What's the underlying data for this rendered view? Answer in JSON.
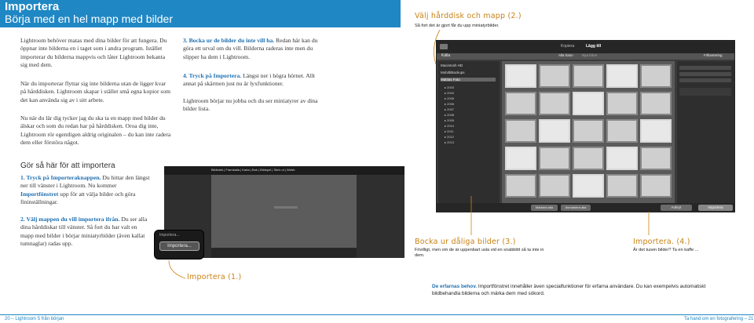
{
  "header": {
    "title": "Importera",
    "subtitle": "Börja med en hel mapp med bilder"
  },
  "intro": {
    "p1": "Lightroom behöver matas med dina bilder för att fungera. Du öppnar inte bilderna en i taget som i andra program. Istället importerar du bilderna mappvis och låter Lightroom bekanta sig med dem.",
    "p2": "När du importerar flyttar sig inte bilderna utan de ligger kvar på hårddisken. Lightroom skapar i stället små egna kopior som det kan använda sig av i sitt arbete.",
    "p3": "Nu när du lär dig tycker jag du ska ta en mapp med bilder du älskar och som du redan har på hårddisken. Oroa dig inte, Lightroom rör egentligen aldrig originalen – du kan inte radera dem eller förstöra något."
  },
  "howto": {
    "heading": "Gör så här för att importera",
    "step1_title": "1. Tryck på Importeraknappen.",
    "step1_text": " Du hittar den längst ner till vänster i Lightroom. Nu kommer ",
    "step1_bold": "Importfönstret",
    "step1_text2": " upp för att välja bilder och göra fininställningar.",
    "step2_title": "2. Välj mappen du vill importera ifrån.",
    "step2_text": " Du ser alla dina hårddiskar till vänster. Så fort du har valt en mapp med bilder i börjar miniatyrbilder (även kallat tumnaglar) radas upp.",
    "step3_title": "3. Bocka ur de bilder du inte vill ha.",
    "step3_text": " Redan här kan du göra ett urval om du vill. Bilderna raderas inte men du slipper ha dem i Lightroom.",
    "step4_title": "4. Tryck på Importera.",
    "step4_text": " Längst ner i högra hörnet. Allt annat på skärmen just nu är lyxfunktioner.",
    "step4_p2": "Lightroom börjar nu jobba och du ser miniatyrer av dina bilder lista."
  },
  "annotations": {
    "a1_title": "Importera (1.)",
    "a2_title": "Välj hårddisk och mapp (2.)",
    "a2_caption": "Så fort det är gjort får du upp miniatyrbilder.",
    "a3_title": "Bocka ur dåliga bilder (3.)",
    "a3_caption": "Frivilligt, men om de är uppenbart usla vid en snabbtitt så ta inte in dem.",
    "a4_title": "Importera. (4.)",
    "a4_caption": "Är det tusen bilder? Ta en kaffe ..."
  },
  "tip": {
    "bold": "De erfarnas behov.",
    "text": " Importfönstret innehåller även specialfunktioner för erfarna användare. Du kan exempelvis automatiskt bildbehandla bilderna och märka dem med sökord."
  },
  "screenshot_left": {
    "nav": "Bibliotek | Framkalla | Karta | Bok | Bildspel | Skriv ut | Webb",
    "import_button": "Importera...",
    "import_hint": "Importera..."
  },
  "screenshot_right": {
    "source_label": "Källa",
    "disk": "Macintosh HD",
    "disk2": "Mobilt/Backups",
    "folder": "Mattias Foto",
    "years": [
      "2003",
      "2004",
      "2005",
      "2006",
      "2007",
      "2008",
      "2009",
      "2010",
      "2011",
      "2012",
      "2013"
    ],
    "tab_all": "Alla foton",
    "tab_new": "Nya foton",
    "right_title": "Filhantering",
    "bottom_import": "Importera",
    "bottom_cancel": "Avbryt",
    "copy_label": "Kopiera",
    "add_label": "Lägg till",
    "check_all": "Markera alla",
    "uncheck_all": "Avmarkera alla"
  },
  "footer": {
    "left": "20 – Lightroom 5 från början",
    "right": "Ta hand om en fotografering – 21"
  },
  "colors": {
    "accent": "#1f87c4",
    "annotation": "#c98214",
    "text": "#333333"
  }
}
